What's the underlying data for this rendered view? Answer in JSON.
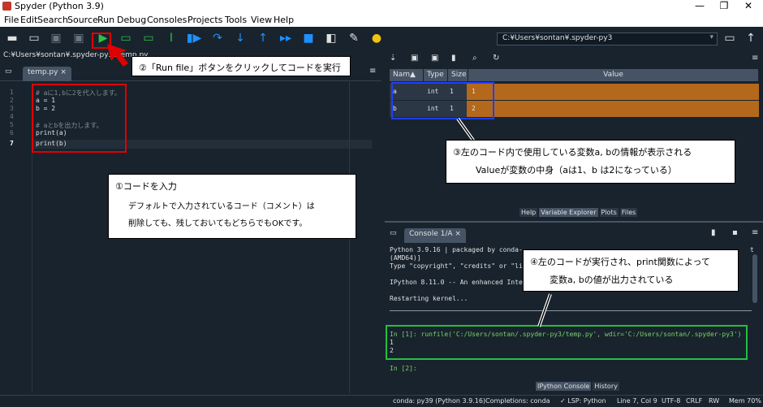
{
  "window": {
    "title": "Spyder (Python 3.9)",
    "controls": [
      "—",
      "❐",
      "✕"
    ]
  },
  "menu": [
    "File",
    "Edit",
    "Search",
    "Source",
    "Run",
    "Debug",
    "Consoles",
    "Projects",
    "Tools",
    "View",
    "Help"
  ],
  "toolbar": {
    "path": "C:¥Users¥sontan¥.spyder-py3"
  },
  "editor": {
    "path": "C:¥Users¥sontan¥.spyder-py3¥temp.py",
    "tab": "temp.py",
    "tab_close": "×",
    "line_numbers": [
      "1",
      "2",
      "3",
      "4",
      "5",
      "6",
      "7"
    ],
    "lines": [
      "# aに1,bに2を代入します。",
      "a = 1",
      "b = 2",
      "",
      "# aとbを出力します。",
      "print(a)",
      "print(b)"
    ]
  },
  "variable_explorer": {
    "columns": [
      "Nam▲",
      "Type",
      "Size",
      "Value"
    ],
    "rows": [
      {
        "name": "a",
        "type": "int",
        "size": "1",
        "value": "1"
      },
      {
        "name": "b",
        "type": "int",
        "size": "1",
        "value": "2"
      }
    ],
    "tabs": [
      "Help",
      "Variable Explorer",
      "Plots",
      "Files"
    ]
  },
  "console": {
    "tab": "Console 1/A",
    "tab_close": "×",
    "lines": [
      "Python 3.9.16 | packaged by conda-",
      "(AMD64)]",
      "Type \"copyright\", \"credits\" or \"li",
      "",
      "IPython 8.11.0 -- An enhanced Inte",
      "",
      "Restarting kernel..."
    ],
    "trailing": "t",
    "run_cmd": "In [1]: runfile('C:/Users/sontan/.spyder-py3/temp.py', wdir='C:/Users/sontan/.spyder-py3')",
    "out1": "1",
    "out2": "2",
    "prompt2": "In [2]:",
    "tabs": [
      "IPython Console",
      "History"
    ]
  },
  "statusbar": {
    "conda": "conda: py39 (Python 3.9.16)",
    "completions": "Completions: conda",
    "lsp": "✓ LSP: Python",
    "position": "Line 7, Col 9",
    "encoding": "UTF-8",
    "eol": "CRLF",
    "rw": "RW",
    "mem": "Mem 70%"
  },
  "annotations": {
    "c1_title": "①コードを入力",
    "c1_line1": "デフォルトで入力されているコード（コメント）は",
    "c1_line2": "削除しても、残しておいてもどちらでもOKです。",
    "c2": "②「Run file」ボタンをクリックしてコードを実行",
    "c3_line1": "③左のコード内で使用している変数a, bの情報が表示される",
    "c3_line2": "Valueが変数の中身（aは1、b は2になっている）",
    "c4_line1": "④左のコードが実行され、print関数によって",
    "c4_line2": "変数a, bの値が出力されている"
  },
  "colors": {
    "background": "#19232d",
    "value_cell": "#b4681c",
    "annotation_red": "#e00000",
    "annotation_blue": "#1f3fff",
    "annotation_green": "#22c040"
  }
}
